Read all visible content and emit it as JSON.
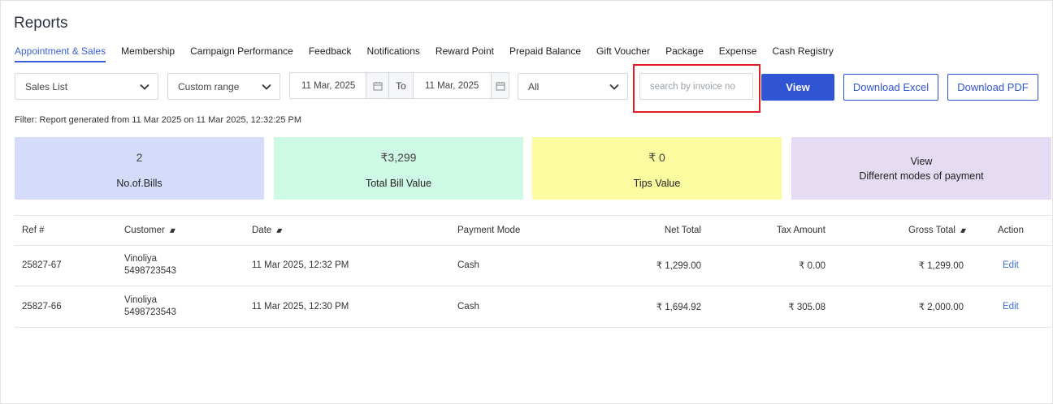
{
  "page": {
    "title": "Reports"
  },
  "tabs": [
    "Appointment & Sales",
    "Membership",
    "Campaign Performance",
    "Feedback",
    "Notifications",
    "Reward Point",
    "Prepaid Balance",
    "Gift Voucher",
    "Package",
    "Expense",
    "Cash Registry"
  ],
  "active_tab": "Appointment & Sales",
  "filters": {
    "report_type": "Sales List",
    "range": "Custom range",
    "date_from": "11 Mar, 2025",
    "to_label": "To",
    "date_to": "11 Mar, 2025",
    "status": "All",
    "search_placeholder": "search by invoice no"
  },
  "buttons": {
    "view": "View",
    "excel": "Download Excel",
    "pdf": "Download PDF"
  },
  "filter_note": {
    "prefix": "Filter: Report generated from ",
    "from": "11 Mar 2025",
    "mid": " on ",
    "on": "11 Mar 2025, 12:32:25 PM"
  },
  "cards": {
    "bills": {
      "value": "2",
      "label": "No.of.Bills"
    },
    "total": {
      "value": "₹3,299",
      "label": "Total Bill Value"
    },
    "tips": {
      "value": "₹ 0",
      "label": "Tips Value"
    },
    "modes": {
      "line1": "View",
      "line2": "Different modes of payment"
    }
  },
  "colors": {
    "accent": "#2f55d4",
    "card_blue": "#d5dcfb",
    "card_green": "#cdf9e5",
    "card_yellow": "#fbfb9f",
    "card_purple": "#e5dbf3",
    "highlight": "#e11c24"
  },
  "table": {
    "headers": {
      "ref": "Ref #",
      "customer": "Customer",
      "date": "Date",
      "mode": "Payment Mode",
      "net": "Net Total",
      "tax": "Tax Amount",
      "gross": "Gross Total",
      "action": "Action"
    },
    "rows": [
      {
        "ref": "25827-67",
        "name": "Vinoliya",
        "phone": "5498723543",
        "date": "11 Mar 2025, 12:32 PM",
        "mode": "Cash",
        "net": "₹ 1,299.00",
        "tax": "₹ 0.00",
        "gross": "₹ 1,299.00",
        "action": "Edit"
      },
      {
        "ref": "25827-66",
        "name": "Vinoliya",
        "phone": "5498723543",
        "date": "11 Mar 2025, 12:30 PM",
        "mode": "Cash",
        "net": "₹ 1,694.92",
        "tax": "₹ 305.08",
        "gross": "₹ 2,000.00",
        "action": "Edit"
      }
    ]
  }
}
